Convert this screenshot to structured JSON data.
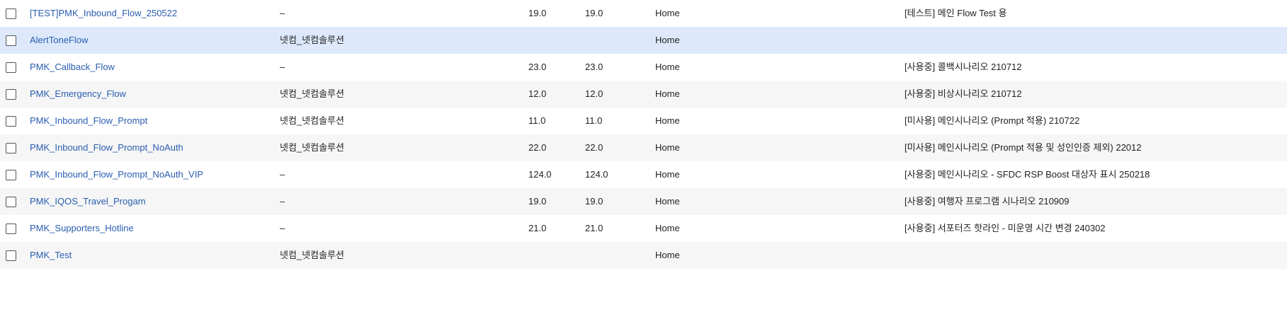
{
  "table": {
    "rows": [
      {
        "name": "[TEST]PMK_Inbound_Flow_250522",
        "owner": "–",
        "value1": "19.0",
        "value2": "19.0",
        "location": "Home",
        "description": "[테스트] 메인 Flow Test 용"
      },
      {
        "name": "AlertToneFlow",
        "owner": "넷컴_넷컴솔루션",
        "value1": "",
        "value2": "",
        "location": "Home",
        "description": ""
      },
      {
        "name": "PMK_Callback_Flow",
        "owner": "–",
        "value1": "23.0",
        "value2": "23.0",
        "location": "Home",
        "description": "[사용중] 콜백시나리오 210712"
      },
      {
        "name": "PMK_Emergency_Flow",
        "owner": "넷컴_넷컴솔루션",
        "value1": "12.0",
        "value2": "12.0",
        "location": "Home",
        "description": "[사용중] 비상시나리오 210712"
      },
      {
        "name": "PMK_Inbound_Flow_Prompt",
        "owner": "넷컴_넷컴솔루션",
        "value1": "11.0",
        "value2": "11.0",
        "location": "Home",
        "description": "[미사용] 메인시나리오 (Prompt 적용) 210722"
      },
      {
        "name": "PMK_Inbound_Flow_Prompt_NoAuth",
        "owner": "넷컴_넷컴솔루션",
        "value1": "22.0",
        "value2": "22.0",
        "location": "Home",
        "description": "[미사용] 메인시나리오 (Prompt 적용 및 성인인증 제외) 22012"
      },
      {
        "name": "PMK_Inbound_Flow_Prompt_NoAuth_VIP",
        "owner": "–",
        "value1": "124.0",
        "value2": "124.0",
        "location": "Home",
        "description": "[사용중] 메인시나리오 - SFDC RSP Boost 대상자 표시 250218"
      },
      {
        "name": "PMK_IQOS_Travel_Progam",
        "owner": "–",
        "value1": "19.0",
        "value2": "19.0",
        "location": "Home",
        "description": "[사용중] 여행자 프로그램 시나리오 210909"
      },
      {
        "name": "PMK_Supporters_Hotline",
        "owner": "–",
        "value1": "21.0",
        "value2": "21.0",
        "location": "Home",
        "description": "[사용중] 서포터즈 핫라인 - 미운영 시간 변경 240302"
      },
      {
        "name": "PMK_Test",
        "owner": "넷컴_넷컴솔루션",
        "value1": "",
        "value2": "",
        "location": "Home",
        "description": ""
      }
    ]
  },
  "colors": {
    "link": "#2a5db0",
    "selected_row": "#dde9fb",
    "striped_row": "#f6f6f6"
  }
}
